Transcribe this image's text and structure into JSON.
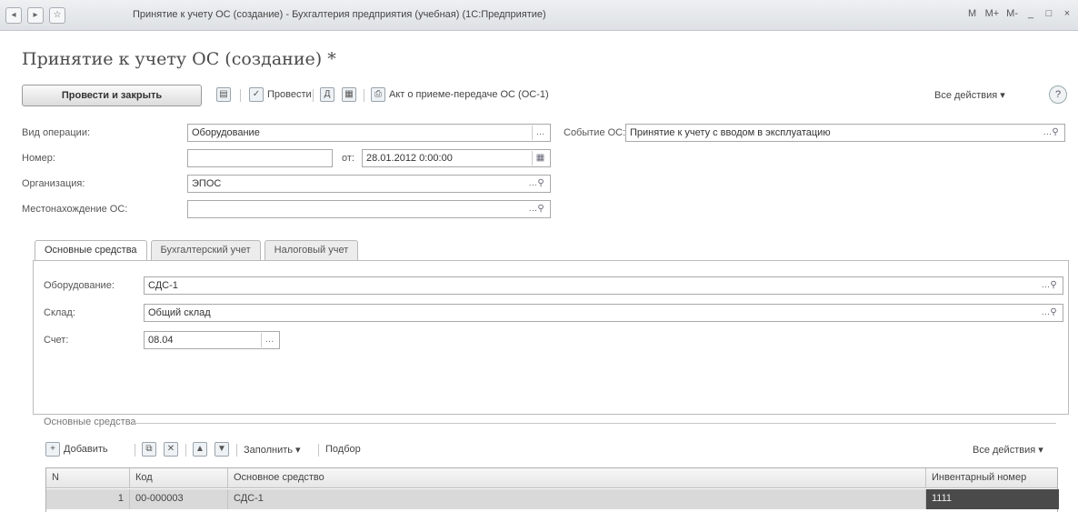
{
  "window": {
    "title": "Принятие к учету ОС (создание) - Бухгалтерия предприятия (учебная) (1С:Предприятие)",
    "controls": [
      "M",
      "M+",
      "M-",
      "_",
      "□",
      "×"
    ]
  },
  "form": {
    "title": "Принятие к учету ОС (создание) *"
  },
  "toolbar": {
    "post_close": "Провести и закрыть",
    "post": "Провести",
    "act": "Акт о приеме-передаче ОС (ОС-1)",
    "all_actions": "Все действия ▾",
    "help": "?"
  },
  "fields": {
    "op_type": {
      "label": "Вид операции:",
      "value": "Оборудование"
    },
    "number": {
      "label": "Номер:",
      "value": "",
      "from_label": "от:",
      "date": "28.01.2012 0:00:00"
    },
    "org": {
      "label": "Организация:",
      "value": "ЭПОС"
    },
    "location": {
      "label": "Местонахождение ОС:",
      "value": ""
    },
    "event": {
      "label": "Событие ОС:",
      "value": "Принятие к учету с вводом в эксплуатацию"
    }
  },
  "tabs": [
    {
      "label": "Основные средства",
      "active": true
    },
    {
      "label": "Бухгалтерский учет",
      "active": false
    },
    {
      "label": "Налоговый учет",
      "active": false
    }
  ],
  "panel": {
    "equipment": {
      "label": "Оборудование:",
      "value": "СДС-1"
    },
    "warehouse": {
      "label": "Склад:",
      "value": "Общий склад"
    },
    "account": {
      "label": "Счет:",
      "value": "08.04"
    }
  },
  "group": {
    "title": "Основные средства",
    "add": "Добавить",
    "fill": "Заполнить ▾",
    "pick": "Подбор",
    "all_actions": "Все действия ▾"
  },
  "table": {
    "columns": [
      "N",
      "Код",
      "Основное средство",
      "Инвентарный номер"
    ],
    "rows": [
      {
        "n": "1",
        "code": "00-000003",
        "name": "СДС-1",
        "inv": "1111"
      }
    ]
  }
}
